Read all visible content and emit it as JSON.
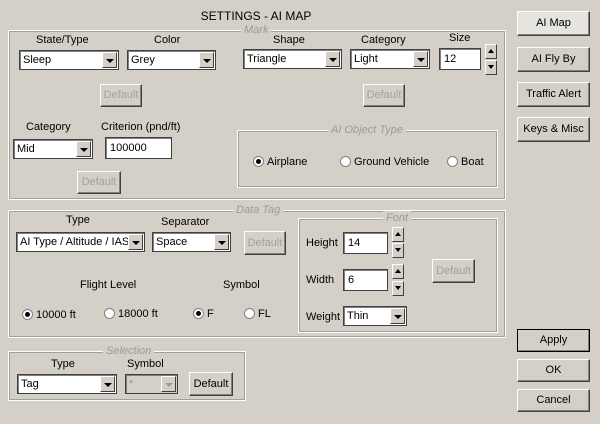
{
  "title": "SETTINGS - AI MAP",
  "side_buttons": [
    {
      "label": "AI Map"
    },
    {
      "label": "AI Fly By"
    },
    {
      "label": "Traffic Alert"
    },
    {
      "label": "Keys & Misc"
    }
  ],
  "actions": {
    "apply": "Apply",
    "ok": "OK",
    "cancel": "Cancel"
  },
  "mark": {
    "group_title": "Mark",
    "state_type_label": "State/Type",
    "state_type_value": "Sleep",
    "color_label": "Color",
    "color_value": "Grey",
    "default_1": "Default",
    "shape_label": "Shape",
    "shape_value": "Triangle",
    "category_label": "Category",
    "category_value": "Light",
    "size_label": "Size",
    "size_value": "12",
    "default_2": "Default",
    "category2_label": "Category",
    "category2_value": "Mid",
    "criterion_label": "Criterion (pnd/ft)",
    "criterion_value": "100000",
    "default_3": "Default",
    "ai_object_type": {
      "group_title": "AI Object Type",
      "options": [
        "Airplane",
        "Ground Vehicle",
        "Boat"
      ],
      "selected": "Airplane"
    }
  },
  "data_tag": {
    "group_title": "Data Tag",
    "type_label": "Type",
    "type_value": "AI Type / Altitude / IAS",
    "separator_label": "Separator",
    "separator_value": "Space",
    "default": "Default",
    "flight_level_label": "Flight Level",
    "flight_level_options": [
      "10000 ft",
      "18000 ft"
    ],
    "flight_level_selected": "10000 ft",
    "symbol_label": "Symbol",
    "symbol_options": [
      "F",
      "FL"
    ],
    "symbol_selected": "F",
    "font": {
      "group_title": "Font",
      "height_label": "Height",
      "height_value": "14",
      "width_label": "Width",
      "width_value": "6",
      "weight_label": "Weight",
      "weight_value": "Thin",
      "default": "Default"
    }
  },
  "selection": {
    "group_title": "Selection",
    "type_label": "Type",
    "type_value": "Tag",
    "symbol_label": "Symbol",
    "symbol_value": "*",
    "default": "Default"
  }
}
